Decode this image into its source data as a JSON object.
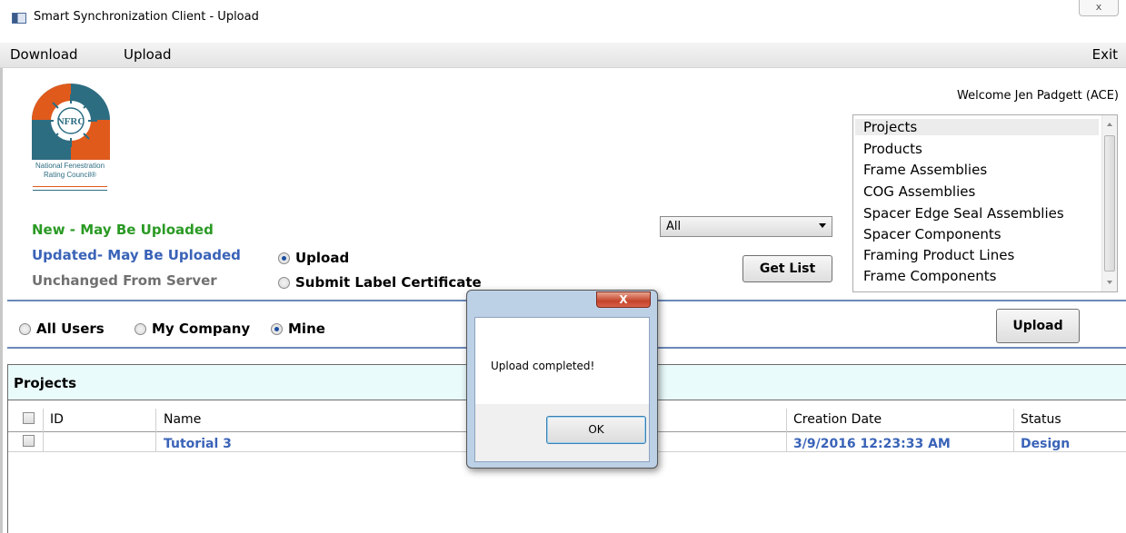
{
  "window": {
    "title": "Smart Synchronization Client - Upload",
    "close_glyph": "ⅹ"
  },
  "menu": {
    "download": "Download",
    "upload": "Upload",
    "exit": "Exit"
  },
  "logo": {
    "mark": "NFRC",
    "caption_line1": "National Fenestration",
    "caption_line2": "Rating Council®",
    "colors": {
      "orange": "#e05a1c",
      "teal": "#2d6d82"
    }
  },
  "legend": {
    "new": "New - May Be Uploaded",
    "updated": "Updated- May Be Uploaded",
    "unchanged": "Unchanged From Server",
    "colors": {
      "new": "#2a9a24",
      "updated": "#3a63b8",
      "unchanged": "#707070"
    }
  },
  "mode": {
    "upload": "Upload",
    "submit_label_certificate": "Submit Label Certificate",
    "selected": "Upload"
  },
  "filter": {
    "dropdown_value": "All",
    "get_list": "Get List"
  },
  "welcome": "Welcome Jen Padgett (ACE)",
  "list": {
    "items": [
      "Projects",
      "Products",
      "Frame Assemblies",
      "COG Assemblies",
      "Spacer Edge Seal Assemblies",
      "Spacer Components",
      "Framing Product Lines",
      "Frame Components"
    ],
    "selected": "Projects"
  },
  "scope": {
    "all_users": "All Users",
    "my_company": "My Company",
    "mine": "Mine",
    "selected": "Mine"
  },
  "upload_button": "Upload",
  "projects": {
    "title": "Projects",
    "columns": {
      "id": "ID",
      "name": "Name",
      "creation_date": "Creation Date",
      "status": "Status"
    },
    "rows": [
      {
        "id": "",
        "name": "Tutorial 3",
        "creation_date": "3/9/2016 12:23:33 AM",
        "status": "Design"
      }
    ]
  },
  "dialog": {
    "close_glyph": "X",
    "message": "Upload completed!",
    "ok": "OK"
  }
}
